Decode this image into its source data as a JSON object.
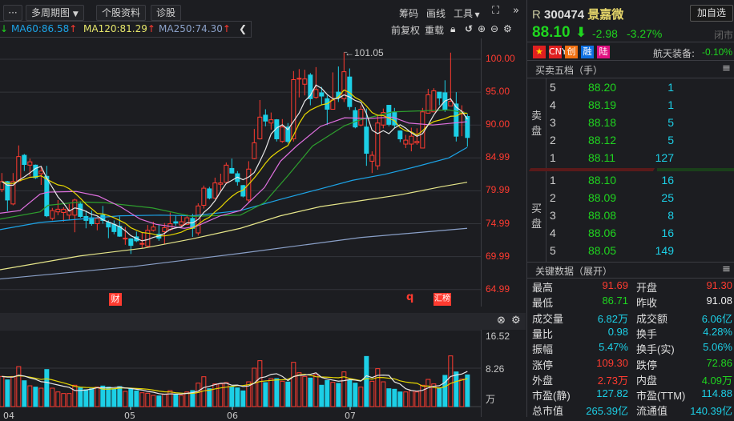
{
  "toolbar": {
    "more": "···",
    "multi_period": "多周期图",
    "stock_info": "个股资料",
    "diagnose": "诊股",
    "chips": "筹码",
    "draw": "画线",
    "tools": "工具",
    "fullscreen_icon": "expand-icon",
    "expand_icon": "double-chevron-right-icon",
    "restore_right": "前复权",
    "reload": "重载"
  },
  "ma_legend": [
    {
      "label": "MA60:86.58",
      "color": "#1ca3e6"
    },
    {
      "label": "MA120:81.29",
      "color": "#e6e66a"
    },
    {
      "label": "MA250:74.30",
      "color": "#8aa0c8"
    }
  ],
  "colors": {
    "up": "#ff3b30",
    "down": "#1ccfe6",
    "ma5": "#e8e8e8",
    "ma10": "#e8d800",
    "ma20": "#e070e0",
    "ma30": "#2ea02e",
    "ma60": "#1ca3e6",
    "ma120": "#e6e68a",
    "ma250": "#8aa0c8"
  },
  "chart_data": {
    "type": "candlestick",
    "price_axis": {
      "ticks": [
        "100.00",
        "95.00",
        "90.00",
        "84.99",
        "79.99",
        "74.99",
        "69.99",
        "64.99"
      ],
      "range": [
        62,
        103
      ]
    },
    "max_annotation": "←101.05",
    "ohlc": [
      [
        80.2,
        82.7,
        79.8,
        81.4
      ],
      [
        81.4,
        81.5,
        76.9,
        78.6
      ],
      [
        78,
        82.7,
        77.8,
        81.4
      ],
      [
        81.5,
        86.9,
        81.3,
        85.2
      ],
      [
        85.4,
        85.6,
        83,
        84
      ],
      [
        83.9,
        84.9,
        82.2,
        84.4
      ],
      [
        83.9,
        84,
        81.8,
        82
      ],
      [
        82.6,
        83.6,
        80.9,
        83
      ],
      [
        82.2,
        83.8,
        76,
        76.2
      ],
      [
        75.8,
        77.4,
        75.5,
        77
      ],
      [
        76.8,
        78.6,
        76.3,
        77.2
      ],
      [
        76.7,
        77.5,
        75.3,
        77.2
      ],
      [
        76.3,
        78,
        75.6,
        77
      ],
      [
        76.3,
        78.8,
        73.7,
        78.6
      ],
      [
        78,
        78.4,
        75.9,
        76.1
      ],
      [
        76.1,
        77,
        74.3,
        75.5
      ],
      [
        75.9,
        77,
        74.7,
        75
      ],
      [
        75,
        76.1,
        74,
        75.8
      ],
      [
        76.3,
        77.7,
        75,
        75.5
      ],
      [
        75.2,
        75.5,
        72.8,
        74.5
      ],
      [
        74.9,
        75.5,
        73.4,
        73.8
      ],
      [
        74.6,
        76.1,
        73,
        73.1
      ],
      [
        72.7,
        74.5,
        71.8,
        72.8
      ],
      [
        72.7,
        72.8,
        70.4,
        71.7
      ],
      [
        73,
        73.8,
        72.2,
        72.4
      ],
      [
        71.9,
        73.6,
        71.3,
        72
      ],
      [
        71.6,
        74.8,
        71.4,
        74
      ],
      [
        74,
        75.3,
        73.8,
        74.5
      ],
      [
        73.4,
        74.8,
        72.4,
        72.8
      ],
      [
        73.8,
        75.1,
        71.9,
        74.4
      ],
      [
        74.1,
        76.7,
        73.9,
        75
      ],
      [
        75.3,
        76.3,
        74.7,
        75.1
      ],
      [
        74.8,
        76.2,
        74.6,
        75.3
      ],
      [
        74.9,
        76.4,
        74.8,
        75.9
      ],
      [
        75.8,
        76.5,
        73,
        74.3
      ],
      [
        73.6,
        78.1,
        73.2,
        77.7
      ],
      [
        77.8,
        80.8,
        77.3,
        80.4
      ],
      [
        80.3,
        80.6,
        78.7,
        78.9
      ],
      [
        78.9,
        82,
        78.8,
        81.2
      ],
      [
        81,
        82.6,
        80,
        81.2
      ],
      [
        81.3,
        84.3,
        81.2,
        83.9
      ],
      [
        83.4,
        84.9,
        82.6,
        82.7
      ],
      [
        82.6,
        83,
        80.8,
        81.4
      ],
      [
        80.8,
        80.9,
        79,
        79.2
      ],
      [
        78.6,
        84.5,
        78.3,
        83.3
      ],
      [
        84.9,
        89.4,
        84.8,
        87.3
      ],
      [
        87.9,
        93.8,
        87.8,
        91.2
      ],
      [
        91.5,
        92.4,
        89.8,
        90.6
      ],
      [
        90.3,
        91.9,
        89.3,
        90.8
      ],
      [
        90.8,
        90.9,
        87.5,
        87.9
      ],
      [
        87.5,
        90.9,
        87.3,
        89.7
      ],
      [
        89.7,
        90.3,
        87.2,
        87.5
      ],
      [
        87.9,
        98.2,
        87.5,
        96.9
      ],
      [
        97,
        98.5,
        94.2,
        97.1
      ],
      [
        96.2,
        98.4,
        94.5,
        97
      ],
      [
        97.6,
        97.9,
        93,
        94
      ],
      [
        94.2,
        98.8,
        94,
        95.4
      ],
      [
        94.9,
        95.8,
        93,
        94.4
      ],
      [
        94,
        94.5,
        90,
        92.4
      ],
      [
        92.4,
        98,
        92.4,
        93.8
      ],
      [
        95,
        98.9,
        93.5,
        94.2
      ],
      [
        94,
        101.05,
        93.5,
        98.1
      ],
      [
        97.3,
        98.6,
        92.3,
        92.8
      ],
      [
        92.2,
        92.7,
        89.5,
        89.7
      ],
      [
        90,
        93,
        89.8,
        92.4
      ],
      [
        89.7,
        92.5,
        83.8,
        85.7
      ],
      [
        84.5,
        86,
        82.7,
        85.4
      ],
      [
        83.8,
        91.6,
        83.2,
        90.3
      ],
      [
        90,
        92.5,
        89.5,
        91.9
      ],
      [
        93,
        93,
        89.8,
        90.1
      ],
      [
        91.9,
        92.6,
        89.5,
        90
      ],
      [
        89.1,
        89.2,
        87.4,
        87.9
      ],
      [
        87.1,
        88.5,
        86.5,
        87.7
      ],
      [
        87.1,
        89.6,
        86,
        88.3
      ],
      [
        87.3,
        89.5,
        87,
        87.5
      ],
      [
        86.5,
        92.6,
        86.5,
        92
      ],
      [
        91.8,
        95.5,
        91.8,
        94.6
      ],
      [
        92,
        95.6,
        92,
        95.2
      ],
      [
        95,
        95,
        93,
        94.1
      ],
      [
        94.9,
        96.8,
        92,
        92.4
      ],
      [
        92.9,
        101,
        92.9,
        93.6
      ],
      [
        93.2,
        95,
        87.5,
        88.3
      ],
      [
        91.7,
        93,
        88.3,
        92
      ],
      [
        91.3,
        91.69,
        86.71,
        88.1
      ]
    ],
    "ma_lines": {
      "ma20": [
        [
          0,
          76.6
        ],
        [
          25,
          77
        ],
        [
          50,
          79.5
        ],
        [
          60,
          79.8
        ],
        [
          95,
          79.9
        ],
        [
          123,
          79.2
        ],
        [
          150,
          77.6
        ],
        [
          175,
          75.7
        ],
        [
          195,
          74.9
        ],
        [
          230,
          74.3
        ],
        [
          245,
          74.6
        ],
        [
          275,
          76.2
        ],
        [
          300,
          77
        ],
        [
          330,
          80.5
        ],
        [
          350,
          84.5
        ],
        [
          370,
          86.8
        ],
        [
          400,
          89.8
        ],
        [
          430,
          91.1
        ],
        [
          460,
          91
        ],
        [
          490,
          91.2
        ],
        [
          510,
          90.3
        ],
        [
          540,
          90
        ],
        [
          583,
          90.5
        ]
      ],
      "ma30": [
        [
          0,
          75.7
        ],
        [
          50,
          76.8
        ],
        [
          60,
          77.8
        ],
        [
          100,
          78.3
        ],
        [
          130,
          78.2
        ],
        [
          190,
          77.4
        ],
        [
          240,
          76.1
        ],
        [
          260,
          76.2
        ],
        [
          300,
          76.3
        ],
        [
          330,
          78.2
        ],
        [
          360,
          82.4
        ],
        [
          390,
          86.8
        ],
        [
          430,
          89.9
        ],
        [
          450,
          90.8
        ],
        [
          490,
          92
        ],
        [
          560,
          92.3
        ],
        [
          583,
          91.8
        ]
      ],
      "ma60": [
        [
          0,
          74.1
        ],
        [
          50,
          75.2
        ],
        [
          100,
          75.7
        ],
        [
          150,
          76.2
        ],
        [
          200,
          76.3
        ],
        [
          240,
          76.2
        ],
        [
          300,
          77
        ],
        [
          350,
          78.7
        ],
        [
          400,
          80.3
        ],
        [
          440,
          81.6
        ],
        [
          480,
          82.5
        ],
        [
          520,
          83.7
        ],
        [
          560,
          85
        ],
        [
          583,
          86.6
        ]
      ],
      "ma120": [
        [
          0,
          68
        ],
        [
          100,
          70.1
        ],
        [
          180,
          71.3
        ],
        [
          240,
          72.7
        ],
        [
          300,
          74.3
        ],
        [
          350,
          76.2
        ],
        [
          400,
          77.6
        ],
        [
          450,
          78.5
        ],
        [
          500,
          79.4
        ],
        [
          550,
          80.6
        ],
        [
          583,
          81.3
        ]
      ],
      "ma250": [
        [
          0,
          66.6
        ],
        [
          167,
          68.5
        ],
        [
          300,
          70.5
        ],
        [
          450,
          72.9
        ],
        [
          583,
          74.3
        ]
      ]
    },
    "volume": {
      "unit": "万",
      "ticks": [
        "16.52",
        "8.26"
      ],
      "max": 16.52,
      "values": [
        6.48,
        5.74,
        6.48,
        8.6,
        5.56,
        4.47,
        4.19,
        3.96,
        7.97,
        3.96,
        3.15,
        2.81,
        2.81,
        4.59,
        4.02,
        3.61,
        3.84,
        4.19,
        4.42,
        4.19,
        3.84,
        4.3,
        3.27,
        3.84,
        3.38,
        2.98,
        2.87,
        2.41,
        2.29,
        2.7,
        3.44,
        2.58,
        2.41,
        3.15,
        3.44,
        5.05,
        6.42,
        3.84,
        4.88,
        4.88,
        5.16,
        4.19,
        4.02,
        3.38,
        5.33,
        8.26,
        9.87,
        5.16,
        6.02,
        6.02,
        5.45,
        5.28,
        9.52,
        7.28,
        6.48,
        6.14,
        6.88,
        4.59,
        5.62,
        5.22,
        4.99,
        7.46,
        5.74,
        5.05,
        4.19,
        10.78,
        5.45,
        8.15,
        5.33,
        3.84,
        3.73,
        3.15,
        3.15,
        3.44,
        3.15,
        4.59,
        5.85,
        4.88,
        4.02,
        6.71,
        10.9,
        7.46,
        5.91,
        6.82
      ]
    },
    "x_labels": [
      "04",
      "05",
      "06",
      "07"
    ],
    "events": [
      "财",
      "q",
      "汇榜"
    ]
  },
  "quote": {
    "prefix": "R",
    "code": "300474",
    "name": "景嘉微",
    "add_watch": "加自选",
    "price": "88.10",
    "change": "-2.98",
    "change_pct": "-3.27%",
    "status": "闭市",
    "tags": [
      "CNY",
      "创",
      "融",
      "陆"
    ],
    "sector": "航天装备:",
    "sector_pct": "-0.10%"
  },
  "orderbook": {
    "title": "买卖五档（手）",
    "sell_label": "卖盘",
    "buy_label": "买盘",
    "asks": [
      {
        "lv": "5",
        "price": "88.20",
        "vol": "1"
      },
      {
        "lv": "4",
        "price": "88.19",
        "vol": "1"
      },
      {
        "lv": "3",
        "price": "88.18",
        "vol": "5"
      },
      {
        "lv": "2",
        "price": "88.12",
        "vol": "5"
      },
      {
        "lv": "1",
        "price": "88.11",
        "vol": "127"
      }
    ],
    "bids": [
      {
        "lv": "1",
        "price": "88.10",
        "vol": "16"
      },
      {
        "lv": "2",
        "price": "88.09",
        "vol": "25"
      },
      {
        "lv": "3",
        "price": "88.08",
        "vol": "8"
      },
      {
        "lv": "4",
        "price": "88.06",
        "vol": "16"
      },
      {
        "lv": "5",
        "price": "88.05",
        "vol": "149"
      }
    ]
  },
  "keydata": {
    "title": "关键数据（展开）",
    "rows": [
      [
        {
          "k": "最高",
          "v": "91.69",
          "c": "red"
        },
        {
          "k": "开盘",
          "v": "91.30",
          "c": "red"
        }
      ],
      [
        {
          "k": "最低",
          "v": "86.71",
          "c": "green"
        },
        {
          "k": "昨收",
          "v": "91.08",
          "c": "white"
        }
      ],
      [
        {
          "k": "成交量",
          "v": "6.82万",
          "c": "cyan"
        },
        {
          "k": "成交额",
          "v": "6.06亿",
          "c": "cyan"
        }
      ],
      [
        {
          "k": "量比",
          "v": "0.98",
          "c": "cyan"
        },
        {
          "k": "换手",
          "v": "4.28%",
          "c": "cyan"
        }
      ],
      [
        {
          "k": "振幅",
          "v": "5.47%",
          "c": "cyan"
        },
        {
          "k": "换手(实)",
          "v": "5.06%",
          "c": "cyan"
        }
      ],
      [
        {
          "k": "涨停",
          "v": "109.30",
          "c": "red"
        },
        {
          "k": "跌停",
          "v": "72.86",
          "c": "green"
        }
      ],
      [
        {
          "k": "外盘",
          "v": "2.73万",
          "c": "red"
        },
        {
          "k": "内盘",
          "v": "4.09万",
          "c": "green"
        }
      ],
      [
        {
          "k": "市盈(静)",
          "v": "127.82",
          "c": "cyan"
        },
        {
          "k": "市盈(TTM)",
          "v": "114.88",
          "c": "cyan"
        }
      ],
      [
        {
          "k": "总市值",
          "v": "265.39亿",
          "c": "cyan"
        },
        {
          "k": "流通值",
          "v": "140.39亿",
          "c": "cyan"
        }
      ]
    ]
  }
}
